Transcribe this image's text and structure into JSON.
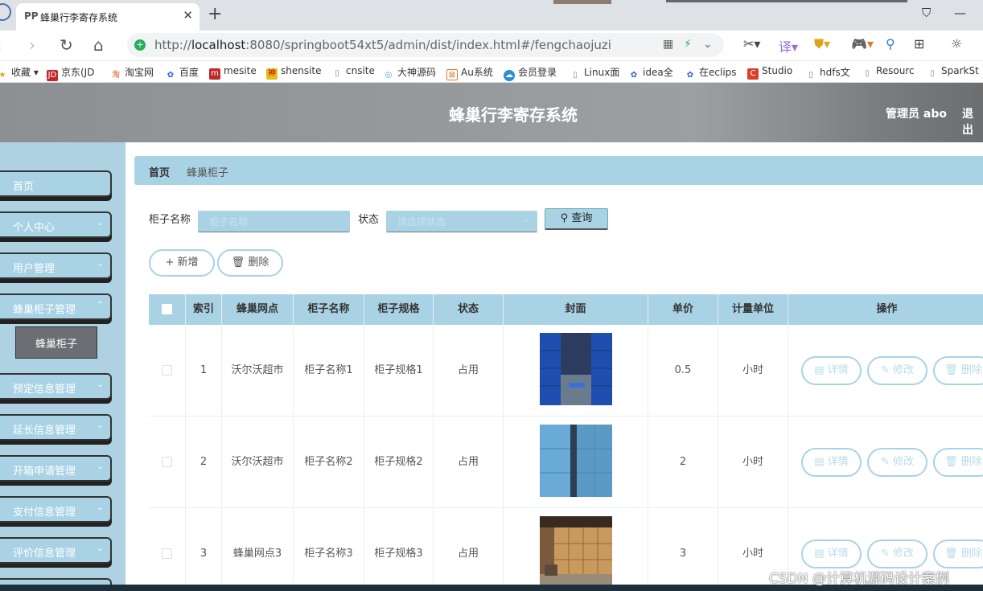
{
  "browser": {
    "tab_icon": "PP",
    "tab_title": "蜂巢行李寄存系统",
    "url_host": "localhost",
    "url_rest": ":8080/springboot54xt5/admin/dist/index.html#/fengchaojuzi",
    "url_prefix": "http://",
    "bookmarks": [
      "收藏",
      "京东(JD",
      "淘宝网",
      "百度",
      "mesite",
      "shensite",
      "cnsite",
      "大神源码",
      "Au系统",
      "会员登录",
      "Linux面",
      "idea全",
      "在eclips",
      "Studio",
      "hdfs文",
      "Resourc",
      "SparkSt"
    ]
  },
  "header": {
    "title": "蜂巢行李寄存系统",
    "admin": "管理员 abo",
    "logout": "退出"
  },
  "sidebar": {
    "items": [
      "首页",
      "个人中心",
      "用户管理",
      "蜂巢柜子管理",
      "预定信息管理",
      "延长信息管理",
      "开箱申请管理",
      "支付信息管理",
      "评价信息管理"
    ],
    "sub_item": "蜂巢柜子"
  },
  "breadcrumb": {
    "home": "首页",
    "current": "蜂巢柜子"
  },
  "search": {
    "name_label": "柜子名称",
    "name_placeholder": "柜子名称",
    "status_label": "状态",
    "status_placeholder": "请选择状态",
    "query_button": "查询"
  },
  "actions": {
    "add": "新增",
    "delete": "删除"
  },
  "table": {
    "headers": [
      "索引",
      "蜂巢网点",
      "柜子名称",
      "柜子规格",
      "状态",
      "封面",
      "单价",
      "计量单位",
      "操作"
    ],
    "rows": [
      {
        "index": "1",
        "site": "沃尔沃超市",
        "name": "柜子名称1",
        "spec": "柜子规格1",
        "status": "占用",
        "price": "0.5",
        "unit": "小时"
      },
      {
        "index": "2",
        "site": "沃尔沃超市",
        "name": "柜子名称2",
        "spec": "柜子规格2",
        "status": "占用",
        "price": "2",
        "unit": "小时"
      },
      {
        "index": "3",
        "site": "蜂巢网点3",
        "name": "柜子名称3",
        "spec": "柜子规格3",
        "status": "占用",
        "price": "3",
        "unit": "小时"
      }
    ],
    "row_actions": {
      "detail": "详情",
      "edit": "修改",
      "remove": "删除"
    }
  },
  "watermark": "CSDN @计算机源码设计案例",
  "colors": {
    "accent": "#a9d3e5",
    "sidebar": "#aed2e2",
    "header": "#8d9093"
  }
}
